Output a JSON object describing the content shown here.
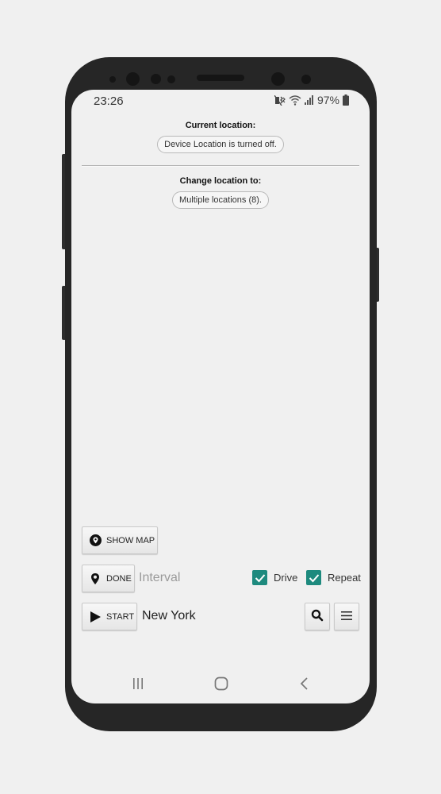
{
  "status_bar": {
    "time": "23:26",
    "battery_percent": "97%",
    "icons": [
      "mute-vibrate-icon",
      "wifi-icon",
      "signal-icon",
      "battery-icon"
    ]
  },
  "current_location": {
    "label": "Current location:",
    "value": "Device Location is turned off."
  },
  "change_location": {
    "label": "Change location to:",
    "value": "Multiple locations (8)."
  },
  "controls": {
    "show_map_label": "SHOW MAP",
    "done_label": "DONE",
    "interval_placeholder": "Interval",
    "start_label": "START",
    "destination": "New York",
    "drive": {
      "label": "Drive",
      "checked": true
    },
    "repeat": {
      "label": "Repeat",
      "checked": true
    }
  },
  "colors": {
    "accent": "#1e8a7e",
    "phone_body": "#262626",
    "screen_bg": "#f0f0f0"
  },
  "nav_bar": {
    "items": [
      "recent-apps",
      "home",
      "back"
    ]
  }
}
